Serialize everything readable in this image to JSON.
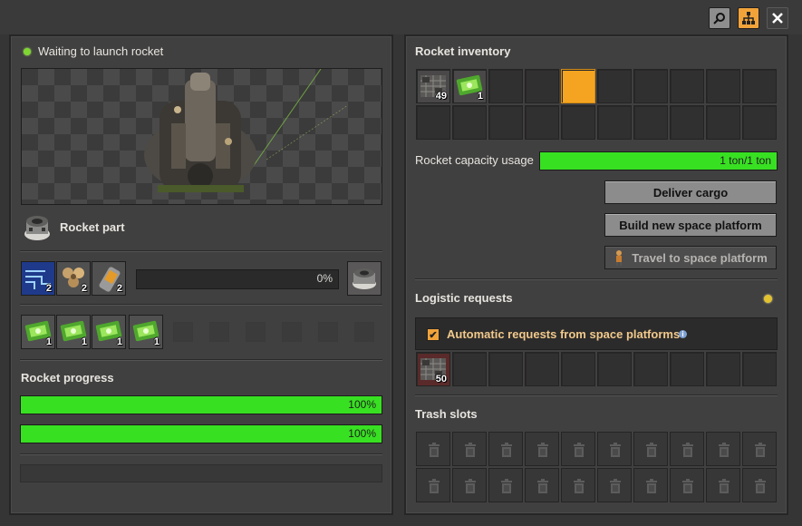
{
  "status": {
    "text": "Waiting to launch rocket"
  },
  "recipe": {
    "name": "Rocket part"
  },
  "ingredients": [
    {
      "icon": "processing-unit-icon",
      "count": "2"
    },
    {
      "icon": "low-density-structure-icon",
      "count": "2"
    },
    {
      "icon": "rocket-fuel-icon",
      "count": "2"
    }
  ],
  "crafting": {
    "progress_text": "0%",
    "progress": 0
  },
  "modules": [
    {
      "icon": "productivity-module-icon",
      "count": "1"
    },
    {
      "icon": "productivity-module-icon",
      "count": "1"
    },
    {
      "icon": "productivity-module-icon",
      "count": "1"
    },
    {
      "icon": "productivity-module-icon",
      "count": "1"
    }
  ],
  "rocket_progress": {
    "title": "Rocket progress",
    "bars": [
      {
        "text": "100%",
        "value": 1.0
      },
      {
        "text": "100%",
        "value": 1.0
      }
    ]
  },
  "inventory": {
    "title": "Rocket inventory",
    "items": [
      {
        "icon": "space-platform-foundation-icon",
        "count": "49"
      },
      {
        "icon": "productivity-module-icon",
        "count": "1"
      }
    ],
    "selected_slot": 4
  },
  "capacity": {
    "label": "Rocket capacity usage",
    "text": "1 ton/1 ton",
    "value": 1.0
  },
  "buttons": {
    "deliver": "Deliver cargo",
    "build": "Build new space platform",
    "travel": "Travel to space platform"
  },
  "logistic": {
    "title": "Logistic requests",
    "auto_label": "Automatic requests from space platforms",
    "auto_checked": true,
    "request_items": [
      {
        "icon": "space-platform-foundation-icon",
        "count": "50"
      }
    ]
  },
  "trash": {
    "title": "Trash slots"
  },
  "colors": {
    "progress_green": "#38e022",
    "accent_orange": "#f1a33a",
    "status_green": "#7fd632"
  }
}
